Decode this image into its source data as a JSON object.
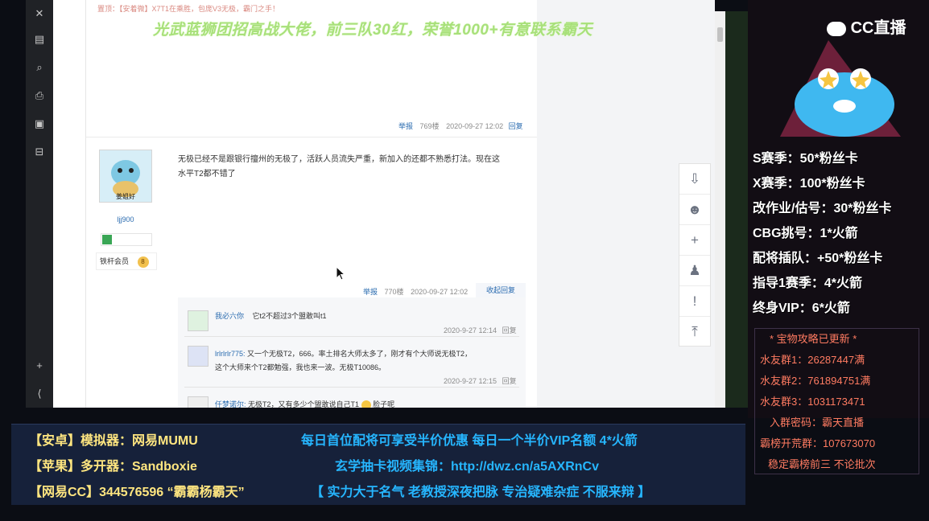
{
  "browser": {
    "top_post_meta": {
      "report": "举报",
      "floor": "769楼",
      "time": "2020-09-27 12:02",
      "reply": "回复"
    },
    "post": {
      "avatar_caption": "姜姐好",
      "username": "ljj900",
      "member": "铁杆会员",
      "level": "8",
      "text_line1": "无极已经不是跟银行擅州的无极了，活跃人员流失严重，新加入的还都不熟悉打法。现在这",
      "text_line2": "水平T2都不错了",
      "meta": {
        "report": "举报",
        "floor": "770楼",
        "time": "2020-09-27 12:02",
        "collapse": "收起回复"
      }
    },
    "replies": [
      {
        "user": "我必六你",
        "text": "它t2不超过3个盟敢叫t1",
        "time": "2020-9-27 12:14",
        "reply": "回复"
      },
      {
        "user": "lrlrlrlr775:",
        "text": "又一个无极T2，666。率土排名大师太多了，刚才有个大师说无极T2，",
        "text2": "这个大师来个T2都勉强，我也来一波。无极T10086。",
        "time": "2020-9-27 12:15",
        "reply": "回复"
      },
      {
        "user": "仟梦诺尔:",
        "text": "无极T2，又有多少个盟敢说自己T1",
        "suffix": "脸子呢"
      }
    ],
    "top_header_text": "置顶：【安着微】X7T1在乘胜，包庞V3无极，霸门之手！"
  },
  "overlay": {
    "banner": "光武蓝狮团招高战大佬，前三队30红，荣誉1000+有意联系霸天"
  },
  "stream": {
    "logo": "CC直播",
    "fan_lines": [
      "S赛季：50*粉丝卡",
      "X赛季：100*粉丝卡",
      "改作业/估号：30*粉丝卡",
      "CBG挑号：1*火箭",
      "配将插队：+50*粉丝卡",
      "指导1赛季：4*火箭",
      "终身VIP：6*火箭"
    ],
    "info_lines": [
      "* 宝物攻略已更新 *",
      "水友群1：26287447满",
      "水友群2：761894751满",
      "水友群3：1031173471",
      "入群密码：霸天直播",
      "霸榜开荒群：107673070",
      "稳定霸榜前三 不论批次"
    ],
    "bottom_left": [
      "【安卓】模拟器：网易MUMU",
      "【苹果】多开器：Sandboxie",
      "【网易CC】344576596 “霸霸杨霸天”"
    ],
    "bottom_center": [
      "每日首位配将可享受半价优惠 每日一个半价VIP名额 4*火箭",
      "玄学抽卡视频集锦：http://dwz.cn/a5AXRnCv",
      "【 实力大于名气 老教授深夜把脉 专治疑难杂症 不服来辩 】"
    ]
  },
  "colors": {
    "fan_text": "#ffffff",
    "info_text": "#ff7b61",
    "bottom_left": "#ffe680",
    "bottom_center": "#26b6ff",
    "banner": "#a8e07a"
  }
}
